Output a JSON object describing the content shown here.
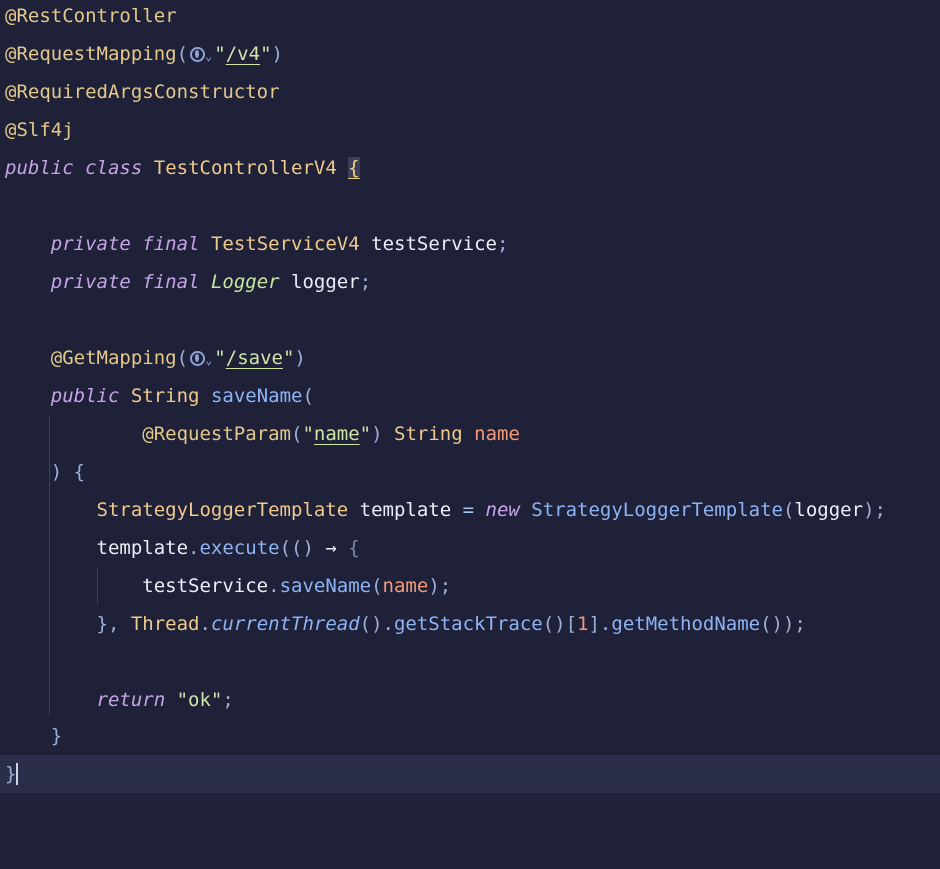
{
  "tokens": {
    "rest_controller": "@RestController",
    "request_mapping": "@RequestMapping",
    "required_args": "@RequiredArgsConstructor",
    "slf4j": "@Slf4j",
    "v4_path": "/v4",
    "kw_public": "public",
    "kw_class": "class",
    "kw_private": "private",
    "kw_final": "final",
    "kw_new": "new",
    "kw_return": "return",
    "class_name": "TestControllerV4",
    "service_type": "TestServiceV4",
    "service_field": "testService",
    "logger_type": "Logger",
    "logger_field": "logger",
    "get_mapping": "@GetMapping",
    "save_path": "/save",
    "string_type": "String",
    "method_name": "saveName",
    "request_param": "@RequestParam",
    "param_label": "name",
    "param_name": "name",
    "template_type": "StrategyLoggerTemplate",
    "template_var": "template",
    "execute": "execute",
    "arrow": "→",
    "thread": "Thread",
    "current_thread": "currentThread",
    "get_stack_trace": "getStackTrace",
    "index": "1",
    "get_method_name": "getMethodName",
    "ok_string": "\"ok\""
  }
}
